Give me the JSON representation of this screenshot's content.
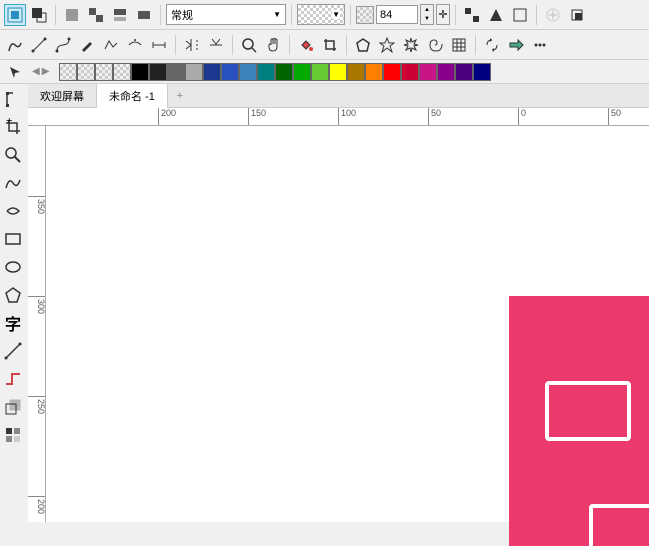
{
  "toolbar1": {
    "style_dropdown": "常规",
    "opacity_value": "84"
  },
  "tabs": {
    "welcome": "欢迎屏幕",
    "doc": "未命名 -1"
  },
  "ruler_h": [
    {
      "pos": 130,
      "label": "200"
    },
    {
      "pos": 220,
      "label": "150"
    },
    {
      "pos": 310,
      "label": "100"
    },
    {
      "pos": 400,
      "label": "50"
    },
    {
      "pos": 490,
      "label": "0"
    },
    {
      "pos": 580,
      "label": "50"
    }
  ],
  "ruler_v": [
    {
      "pos": 70,
      "label": "350"
    },
    {
      "pos": 170,
      "label": "300"
    },
    {
      "pos": 270,
      "label": "250"
    },
    {
      "pos": 370,
      "label": "200"
    }
  ],
  "palette": [
    "#ffffff",
    "#ffffff",
    "#ffffff",
    "#ffffff",
    "#000000",
    "#222222",
    "#666666",
    "#aaaaaa",
    "#1b3a8f",
    "#2a52be",
    "#3b83bd",
    "#008080",
    "#006400",
    "#00aa00",
    "#66cc33",
    "#ffff00",
    "#aa7700",
    "#ff7f00",
    "#ff0000",
    "#cc0033",
    "#c71585",
    "#8b008b",
    "#4b0082",
    "#000080"
  ]
}
